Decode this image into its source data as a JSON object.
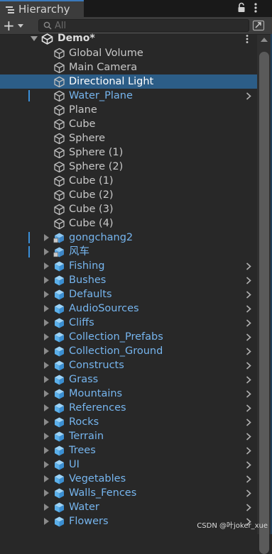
{
  "window": {
    "tab_title": "Hierarchy"
  },
  "toolbar": {
    "add_label": "+",
    "search_placeholder": "All"
  },
  "scene": {
    "name": "Demo*"
  },
  "items": [
    {
      "label": "Global Volume",
      "icon": "gameobject-outline",
      "color": "gray"
    },
    {
      "label": "Main Camera",
      "icon": "gameobject-outline",
      "color": "gray"
    },
    {
      "label": "Directional Light",
      "icon": "gameobject-outline",
      "color": "gray",
      "selected": true
    },
    {
      "label": "Water_Plane",
      "icon": "gameobject-outline",
      "color": "blue",
      "has_arrow": true,
      "marker": true
    },
    {
      "label": "Plane",
      "icon": "gameobject-outline",
      "color": "gray"
    },
    {
      "label": "Cube",
      "icon": "gameobject-outline",
      "color": "gray"
    },
    {
      "label": "Sphere",
      "icon": "gameobject-outline",
      "color": "gray"
    },
    {
      "label": "Sphere (1)",
      "icon": "gameobject-outline",
      "color": "gray"
    },
    {
      "label": "Sphere (2)",
      "icon": "gameobject-outline",
      "color": "gray"
    },
    {
      "label": "Cube (1)",
      "icon": "gameobject-outline",
      "color": "gray"
    },
    {
      "label": "Cube (2)",
      "icon": "gameobject-outline",
      "color": "gray"
    },
    {
      "label": "Cube (3)",
      "icon": "gameobject-outline",
      "color": "gray"
    },
    {
      "label": "Cube (4)",
      "icon": "gameobject-outline",
      "color": "gray"
    },
    {
      "label": "gongchang2",
      "icon": "model-prefab",
      "color": "blue",
      "foldout": true,
      "marker": true
    },
    {
      "label": "风车",
      "icon": "model-prefab",
      "color": "blue",
      "foldout": true,
      "marker": true
    },
    {
      "label": "Fishing",
      "icon": "prefab-cube",
      "color": "blue",
      "foldout": true,
      "has_arrow": true
    },
    {
      "label": "Bushes",
      "icon": "prefab-cube",
      "color": "blue",
      "foldout": true,
      "has_arrow": true
    },
    {
      "label": "Defaults",
      "icon": "prefab-cube",
      "color": "blue",
      "foldout": true,
      "has_arrow": true
    },
    {
      "label": "AudioSources",
      "icon": "prefab-cube",
      "color": "blue",
      "foldout": true,
      "has_arrow": true
    },
    {
      "label": "Cliffs",
      "icon": "prefab-cube",
      "color": "blue",
      "foldout": true,
      "has_arrow": true
    },
    {
      "label": "Collection_Prefabs",
      "icon": "prefab-cube",
      "color": "blue",
      "foldout": true,
      "has_arrow": true
    },
    {
      "label": "Collection_Ground",
      "icon": "prefab-cube",
      "color": "blue",
      "foldout": true,
      "has_arrow": true
    },
    {
      "label": "Constructs",
      "icon": "prefab-cube",
      "color": "blue",
      "foldout": true,
      "has_arrow": true
    },
    {
      "label": "Grass",
      "icon": "prefab-cube",
      "color": "blue",
      "foldout": true,
      "has_arrow": true
    },
    {
      "label": "Mountains",
      "icon": "prefab-cube",
      "color": "blue",
      "foldout": true,
      "has_arrow": true
    },
    {
      "label": "References",
      "icon": "prefab-cube",
      "color": "blue",
      "foldout": true,
      "has_arrow": true
    },
    {
      "label": "Rocks",
      "icon": "prefab-cube",
      "color": "blue",
      "foldout": true,
      "has_arrow": true
    },
    {
      "label": "Terrain",
      "icon": "prefab-cube",
      "color": "blue",
      "foldout": true,
      "has_arrow": true
    },
    {
      "label": "Trees",
      "icon": "prefab-cube",
      "color": "blue",
      "foldout": true,
      "has_arrow": true
    },
    {
      "label": "UI",
      "icon": "prefab-cube",
      "color": "blue",
      "foldout": true,
      "has_arrow": true
    },
    {
      "label": "Vegetables",
      "icon": "prefab-cube",
      "color": "blue",
      "foldout": true,
      "has_arrow": true
    },
    {
      "label": "Walls_Fences",
      "icon": "prefab-cube",
      "color": "blue",
      "foldout": true,
      "has_arrow": true
    },
    {
      "label": "Water",
      "icon": "prefab-cube",
      "color": "blue",
      "foldout": true,
      "has_arrow": true
    },
    {
      "label": "Flowers",
      "icon": "prefab-cube",
      "color": "blue",
      "foldout": true,
      "has_arrow": true
    }
  ],
  "colors": {
    "selection": "#2c5d87",
    "prefab_text": "#76b5ee",
    "object_text": "#c8c8c8",
    "panel": "#282828"
  },
  "watermark": "CSDN @叶joker_xue"
}
